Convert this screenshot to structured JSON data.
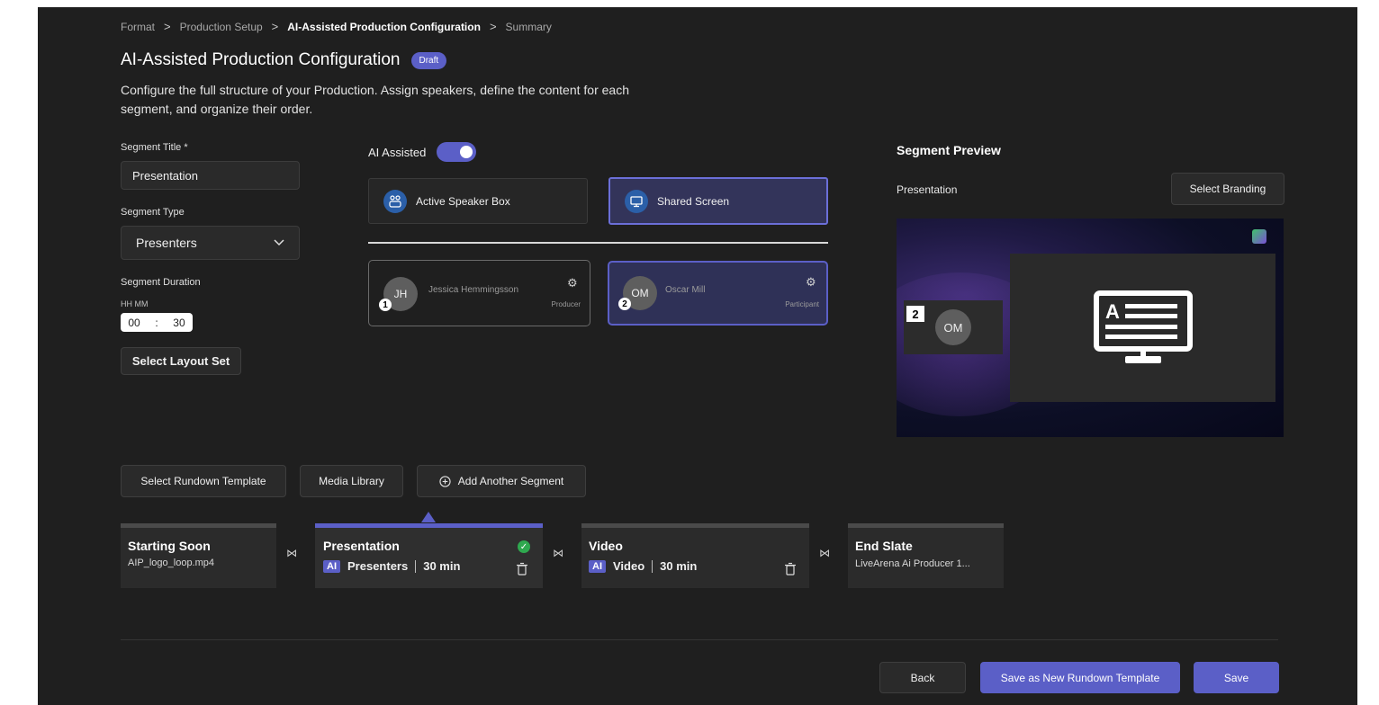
{
  "breadcrumb": [
    {
      "label": "Format",
      "current": false
    },
    {
      "label": "Production Setup",
      "current": false
    },
    {
      "label": "AI-Assisted Production Configuration",
      "current": true
    },
    {
      "label": "Summary",
      "current": false
    }
  ],
  "page": {
    "title": "AI-Assisted Production Configuration",
    "badge": "Draft",
    "description": "Configure the full structure of your Production. Assign speakers, define the content for each segment, and organize their order."
  },
  "form": {
    "segment_title_label": "Segment Title *",
    "segment_title_value": "Presentation",
    "segment_type_label": "Segment Type",
    "segment_type_value": "Presenters",
    "segment_duration_label": "Segment Duration",
    "duration_format": "HH MM",
    "duration_hh": "00",
    "duration_sep": ":",
    "duration_mm": "30",
    "select_layout_set": "Select Layout Set"
  },
  "ai_assisted": {
    "label": "AI Assisted",
    "enabled": true
  },
  "layouts": [
    {
      "label": "Active Speaker Box",
      "selected": false,
      "icon": "speaker-box-icon"
    },
    {
      "label": "Shared Screen",
      "selected": true,
      "icon": "monitor-icon"
    }
  ],
  "participants": [
    {
      "number": "1",
      "initials": "JH",
      "name": "Jessica Hemmingsson",
      "role": "Producer",
      "selected": false
    },
    {
      "number": "2",
      "initials": "OM",
      "name": "Oscar Mill",
      "role": "Participant",
      "selected": true
    }
  ],
  "preview": {
    "heading": "Segment Preview",
    "segment_name": "Presentation",
    "select_branding": "Select Branding",
    "tile_number": "2",
    "tile_initials": "OM",
    "content_icon": "presentation-screen-icon"
  },
  "actions": {
    "select_rundown_template": "Select Rundown Template",
    "media_library": "Media Library",
    "add_segment": "Add Another Segment"
  },
  "segments": [
    {
      "title": "Starting Soon",
      "detail": "AIP_logo_loop.mp4",
      "ai": false,
      "active": false
    },
    {
      "title": "Presentation",
      "ai": true,
      "ai_label": "AI",
      "type": "Presenters",
      "duration": "30 min",
      "active": true,
      "check": true,
      "deletable": true
    },
    {
      "title": "Video",
      "ai": true,
      "ai_label": "AI",
      "type": "Video",
      "duration": "30 min",
      "active": false,
      "deletable": true
    },
    {
      "title": "End Slate",
      "detail": "LiveArena Ai Producer 1...",
      "ai": false,
      "active": false
    }
  ],
  "footer": {
    "back": "Back",
    "save_template": "Save as New Rundown Template",
    "save": "Save"
  },
  "colors": {
    "accent": "#5b5fc7",
    "background": "#1f1f1f",
    "success": "#2fa84f"
  }
}
